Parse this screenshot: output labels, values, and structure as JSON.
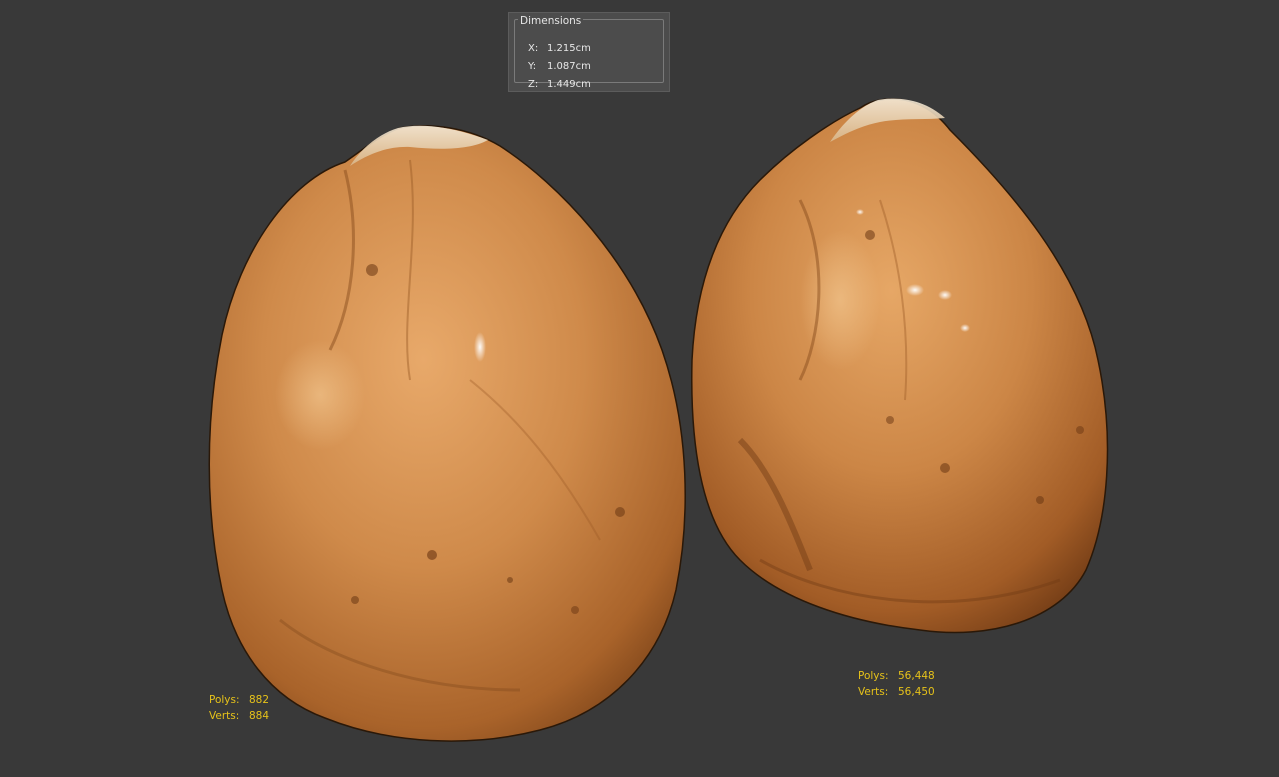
{
  "viewport": {
    "background": "#393939"
  },
  "dimensions_panel": {
    "title": "Dimensions",
    "x_label": "X:",
    "x_value": "1.215cm",
    "y_label": "Y:",
    "y_value": "1.087cm",
    "z_label": "Z:",
    "z_value": "1.449cm"
  },
  "left_model_stats": {
    "polys_label": "Polys:",
    "polys_value": "882",
    "verts_label": "Verts:",
    "verts_value": "884"
  },
  "right_model_stats": {
    "polys_label": "Polys:",
    "polys_value": "56,448",
    "verts_label": "Verts:",
    "verts_value": "56,450"
  },
  "colors": {
    "stats_text": "#e6c21a",
    "nut_base": "#c27a3c",
    "nut_light": "#e1a263",
    "nut_dark": "#7a4419"
  }
}
